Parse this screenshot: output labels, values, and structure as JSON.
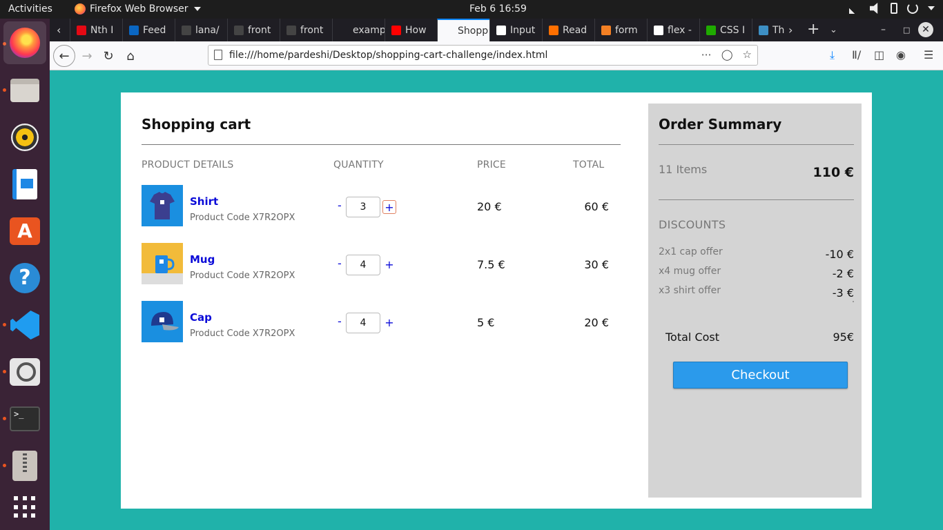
{
  "topbar": {
    "activities": "Activities",
    "app_name": "Firefox Web Browser",
    "clock": "Feb 6  16:59"
  },
  "tabs": [
    {
      "label": "Nth I",
      "color": "#e50914"
    },
    {
      "label": "Feed",
      "color": "#0a66c2"
    },
    {
      "label": "lana/",
      "color": "#444444"
    },
    {
      "label": "front",
      "color": "#444444"
    },
    {
      "label": "front",
      "color": "#444444"
    },
    {
      "label": "example",
      "color": "#1f1e24"
    },
    {
      "label": "How",
      "color": "#ff0000"
    },
    {
      "label": "Shopp",
      "color": "#f9f9fb"
    },
    {
      "label": "Input",
      "color": "#ffffff"
    },
    {
      "label": "Read",
      "color": "#ff6f00"
    },
    {
      "label": "form",
      "color": "#f48024"
    },
    {
      "label": "flex -",
      "color": "#ffffff"
    },
    {
      "label": "CSS I",
      "color": "#1faa00"
    },
    {
      "label": "Th",
      "color": "#3d8fc4"
    }
  ],
  "navbar": {
    "url": "file:///home/pardeshi/Desktop/shopping-cart-challenge/index.html"
  },
  "cart": {
    "title": "Shopping cart",
    "columns": {
      "details": "PRODUCT DETAILS",
      "quantity": "QUANTITY",
      "price": "PRICE",
      "total": "TOTAL"
    },
    "minus_label": "-",
    "plus_label": "+",
    "products": [
      {
        "name": "Shirt",
        "code": "Product Code X7R2OPX",
        "quantity": "3",
        "price": "20 €",
        "total": "60 €",
        "thumb_color": "#1a8fe0"
      },
      {
        "name": "Mug",
        "code": "Product Code X7R2OPX",
        "quantity": "4",
        "price": "7.5 €",
        "total": "30 €",
        "thumb_color": "#f2bb3a"
      },
      {
        "name": "Cap",
        "code": "Product Code X7R2OPX",
        "quantity": "4",
        "price": "5 €",
        "total": "20 €",
        "thumb_color": "#1a8fe0"
      }
    ]
  },
  "summary": {
    "title": "Order Summary",
    "items_count": "11 Items",
    "subtotal": "110 €",
    "discounts_title": "DISCOUNTS",
    "discounts": [
      {
        "name": "2x1 cap offer",
        "amount": "-10 €"
      },
      {
        "name": "x4 mug offer",
        "amount": "-2 €"
      },
      {
        "name": "x3 shirt offer",
        "amount": "-3 €"
      }
    ],
    "total_label": "Total Cost",
    "total_value": "95€",
    "checkout_label": "Checkout",
    "accent_color": "#2b9aeb"
  }
}
